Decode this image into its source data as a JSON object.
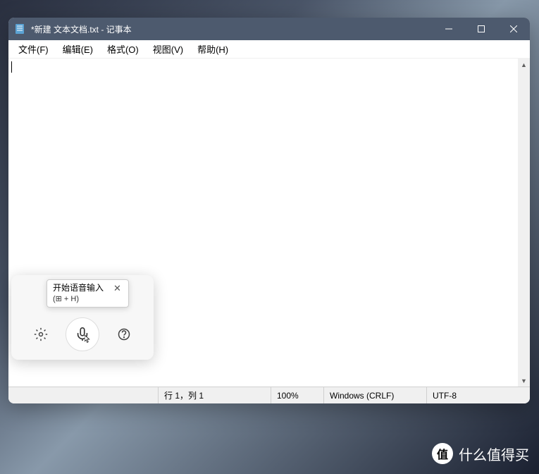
{
  "window": {
    "title": "*新建 文本文档.txt - 记事本"
  },
  "menu": {
    "file": "文件(F)",
    "edit": "编辑(E)",
    "format": "格式(O)",
    "view": "视图(V)",
    "help": "帮助(H)"
  },
  "textarea": {
    "content": ""
  },
  "statusbar": {
    "position": "行 1，列 1",
    "zoom": "100%",
    "eol": "Windows (CRLF)",
    "encoding": "UTF-8"
  },
  "voice_panel": {
    "tooltip_title": "开始语音输入",
    "tooltip_shortcut": "(⊞ + H)"
  },
  "watermark": {
    "badge": "值",
    "text": "什么值得买"
  }
}
